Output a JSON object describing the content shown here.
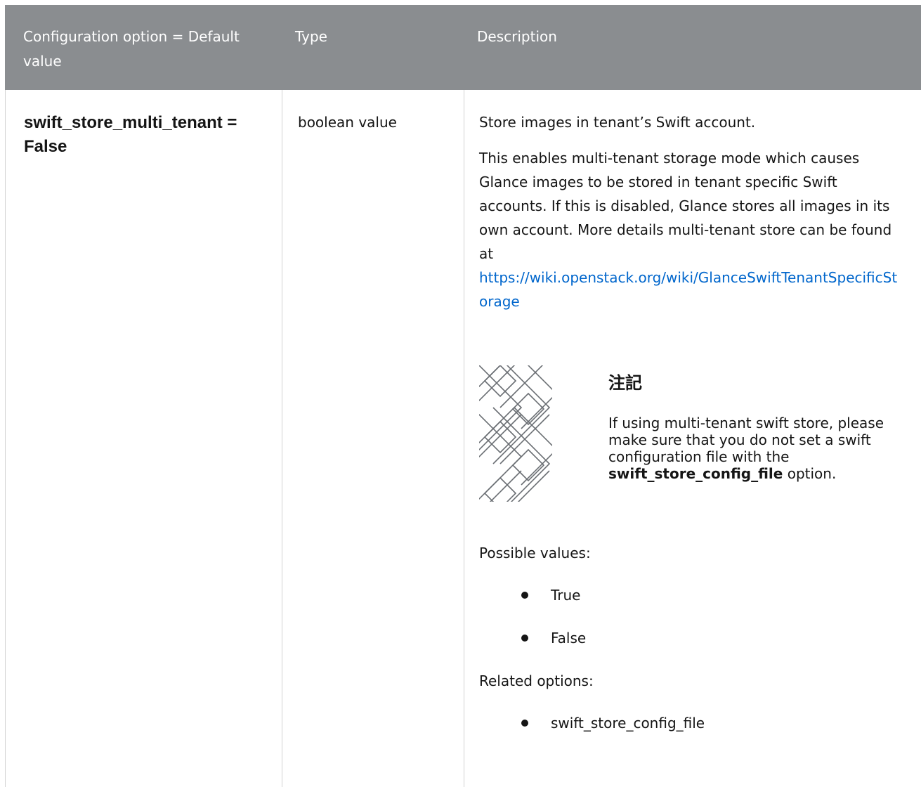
{
  "table": {
    "headers": {
      "config": "Configuration option = Default value",
      "type": "Type",
      "description": "Description"
    },
    "row": {
      "config": "swift_store_multi_tenant = False",
      "type": "boolean value",
      "summary": "Store images in tenant’s Swift account.",
      "detail": "This enables multi-tenant storage mode which causes Glance images to be stored in tenant specific Swift accounts. If this is disabled, Glance stores all images in its own account. More details multi-tenant store can be found at",
      "link": "https://wiki.openstack.org/wiki/GlanceSwiftTenantSpecificStorage",
      "note": {
        "title": "注記",
        "text_before": "If using multi-tenant swift store, please make sure that you do not set a swift configuration file with the",
        "option_name": "swift_store_config_file",
        "text_after": "option."
      },
      "possible_values_label": "Possible values:",
      "possible_values": [
        "True",
        "False"
      ],
      "related_options_label": "Related options:",
      "related_options": [
        "swift_store_config_file"
      ]
    }
  },
  "icons": {
    "note_icon": "note-pattern-icon",
    "bullet": "bullet-dot-icon"
  },
  "colors": {
    "header_bg": "#8a8d90",
    "header_text": "#ffffff",
    "link": "#0066cc",
    "text": "#151515",
    "border": "#d2d2d2"
  }
}
